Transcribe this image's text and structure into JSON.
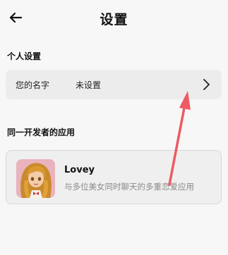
{
  "header": {
    "title": "设置"
  },
  "personal": {
    "section_title": "个人设置",
    "name_label": "您的名字",
    "name_value": "未设置"
  },
  "apps": {
    "section_title": "同一开发者的应用",
    "items": [
      {
        "name": "Lovey",
        "description": "与多位美女同时聊天的多重恋爱应用"
      }
    ]
  },
  "icons": {
    "back": "arrow-left-icon",
    "row_chevron": "chevron-right-icon",
    "annotation": "red-arrow-annotation"
  },
  "colors": {
    "background": "#f7f7f7",
    "row_background": "#ececec",
    "annotation": "#ee5a63"
  }
}
